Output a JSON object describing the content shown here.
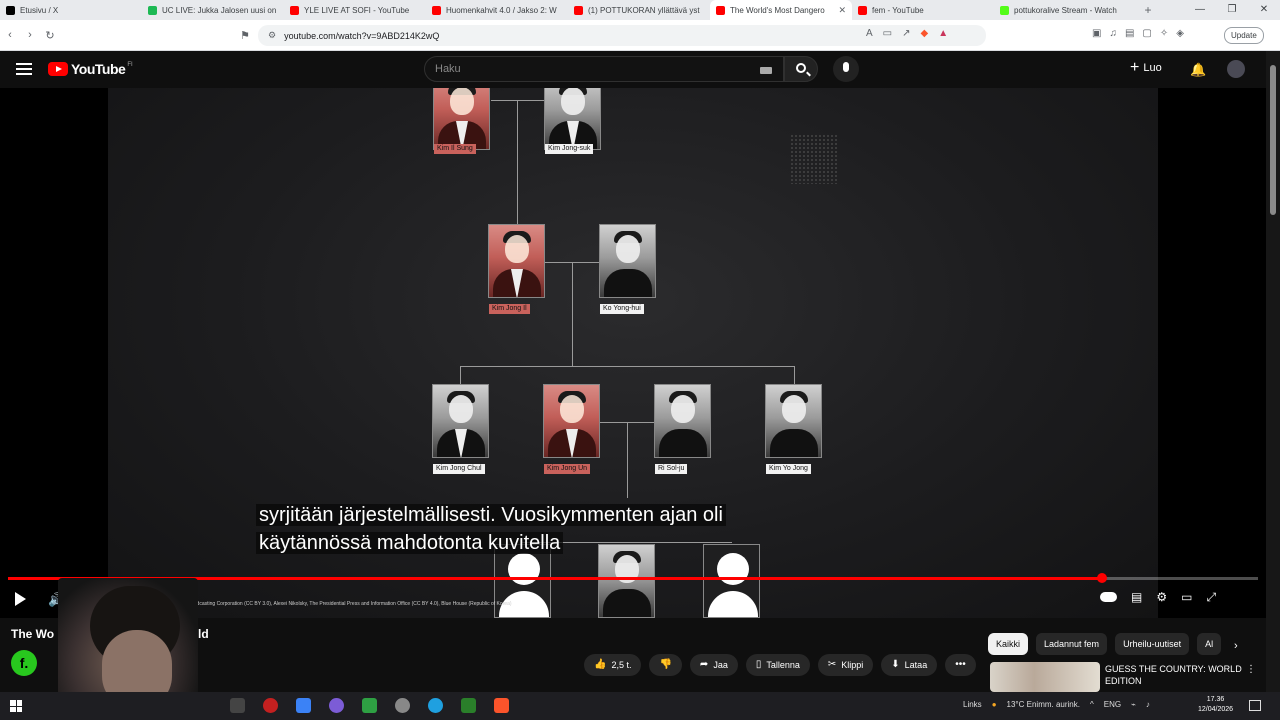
{
  "browser": {
    "tabs": [
      {
        "title": "Etusivu / X",
        "color": "#000000"
      },
      {
        "title": "UC LIVE: Jukka Jalosen uusi on",
        "color": "#1db954"
      },
      {
        "title": "YLE LIVE AT SOFI - YouTube",
        "color": "#ff0000"
      },
      {
        "title": "Huomenkahvit 4.0 / Jakso 2: W",
        "color": "#ff0000"
      },
      {
        "title": "(1) POTTUKORAN yllättävä yst",
        "color": "#ff0000"
      },
      {
        "title": "The World's Most Dangero",
        "color": "#ff0000",
        "active": true
      },
      {
        "title": "fem - YouTube",
        "color": "#ff0000"
      },
      {
        "title": "pottukoralive Stream - Watch",
        "color": "#53fc18"
      }
    ],
    "url": "youtube.com/watch?v=9ABD214K2wQ",
    "update_label": "Update"
  },
  "youtube": {
    "logo_text": "YouTube",
    "logo_region": "FI",
    "search_placeholder": "Haku",
    "create_label": "Luo"
  },
  "video": {
    "people": {
      "p1": "Kim Il Sung",
      "p2": "Kim Jong-suk",
      "p3": "Kim Jong Il",
      "p4": "Ko Yong-hui",
      "p5": "Kim Jong Chul",
      "p6": "Kim Jong Un",
      "p7": "Ri Sol-ju",
      "p8": "Kim Yo Jong"
    },
    "subtitle_line1": "syrjitään järjestelmällisesti.  Vuosikymmenten ajan oli",
    "subtitle_line2": "käytännössä mahdotonta kuvitella",
    "credits": "Broadcasting Corporation (CC BY 3.0), Alexei Nikolsky, The Presidential Press and Information Office (CC BY 4.0), Blue House (Republic of Korea)",
    "progress_fraction": 0.875
  },
  "below": {
    "title_left": "The Wo",
    "title_right": "ld",
    "channel_initial": "f.",
    "likes": "2,5 t.",
    "share": "Jaa",
    "save": "Tallenna",
    "clip": "Klippi",
    "download": "Lataa"
  },
  "sidebar": {
    "chips": [
      "Kaikki",
      "Ladannut fem",
      "Urheilu-uutiset",
      "Al"
    ],
    "rec_title": "GUESS THE COUNTRY: WORLD EDITION"
  },
  "taskbar": {
    "links": "Links",
    "weather": "13°C  Enimm. aurink.",
    "lang": "ENG",
    "time": "17.36",
    "date": "12/04/2026"
  }
}
